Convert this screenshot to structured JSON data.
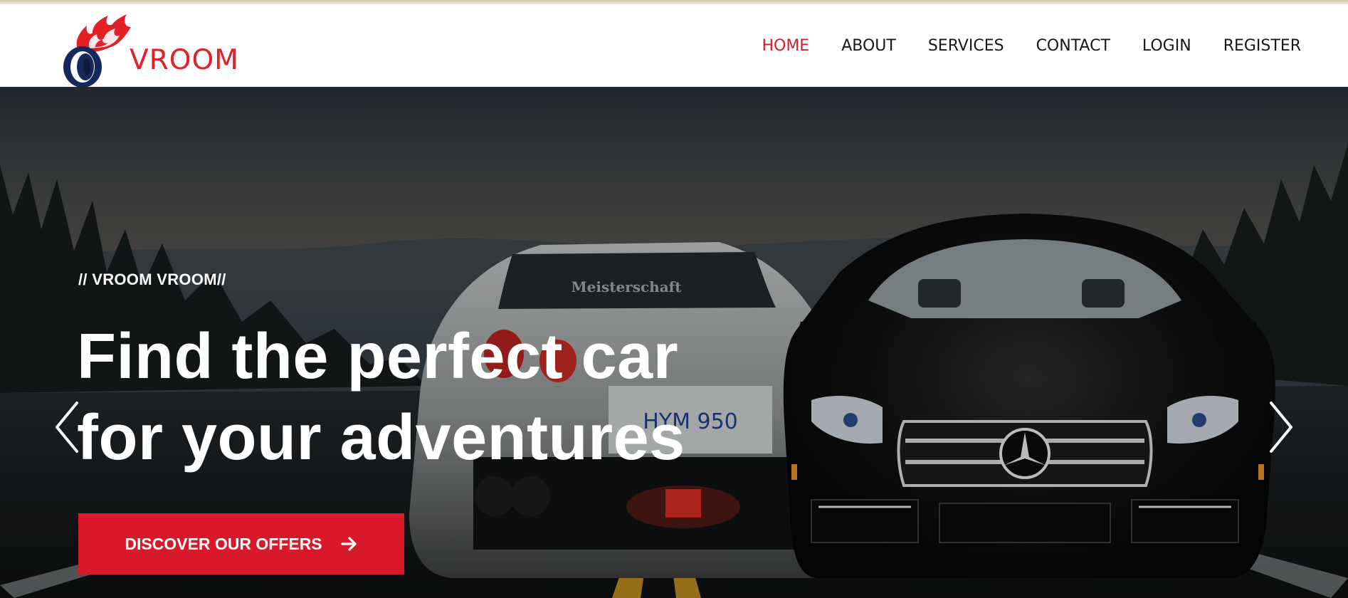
{
  "brand": {
    "name": "VROOM",
    "primary_color": "#e32026",
    "dark_color": "#15285b"
  },
  "nav": {
    "items": [
      {
        "label": "HOME",
        "active": true
      },
      {
        "label": "ABOUT",
        "active": false
      },
      {
        "label": "SERVICES",
        "active": false
      },
      {
        "label": "CONTACT",
        "active": false
      },
      {
        "label": "LOGIN",
        "active": false
      },
      {
        "label": "REGISTER",
        "active": false
      }
    ]
  },
  "hero": {
    "eyebrow": "// VROOM VROOM//",
    "headline_line1": "Find the perfect car",
    "headline_line2": "for your adventures",
    "cta_label": "DISCOVER OUR OFFERS",
    "cta_icon": "arrow-right-icon",
    "cta_color": "#d8192a",
    "prev_icon": "chevron-left-icon",
    "next_icon": "chevron-right-icon",
    "plate_text": "HYM 950",
    "rear_window_text": "Meisterschaft"
  }
}
